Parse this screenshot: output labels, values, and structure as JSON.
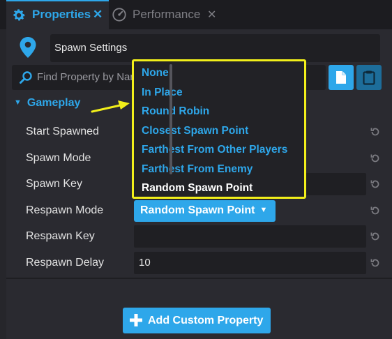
{
  "tabs": [
    {
      "label": "Properties",
      "active": true
    },
    {
      "label": "Performance",
      "active": false
    }
  ],
  "tab_close_glyph": "✕",
  "object_name": "Spawn Settings",
  "search": {
    "placeholder": "Find Property by Name"
  },
  "section": {
    "label": "Gameplay"
  },
  "properties": [
    {
      "label": "Start Spawned"
    },
    {
      "label": "Spawn Mode"
    },
    {
      "label": "Spawn Key",
      "value": ""
    },
    {
      "label": "Respawn Mode",
      "value": "Random Spawn Point"
    },
    {
      "label": "Respawn Key",
      "value": ""
    },
    {
      "label": "Respawn Delay",
      "value": "10"
    }
  ],
  "dropdown_options": [
    "None",
    "In Place",
    "Round Robin",
    "Closest Spawn Point",
    "Farthest From Other Players",
    "Farthest From Enemy",
    "Random Spawn Point"
  ],
  "selected_option_index": 6,
  "add_button": {
    "label": "Add Custom Property"
  },
  "colors": {
    "accent": "#2ea7ea",
    "highlight_border": "#f2ef1a",
    "panel": "#2a2a30",
    "field": "#1f1f23"
  },
  "icons": [
    "gear-icon",
    "speedometer-icon",
    "close-icon",
    "location-pin-icon",
    "search-icon",
    "copy-icon",
    "paste-icon",
    "chevron-down-icon",
    "reset-icon",
    "plus-icon",
    "arrow-annotation"
  ]
}
